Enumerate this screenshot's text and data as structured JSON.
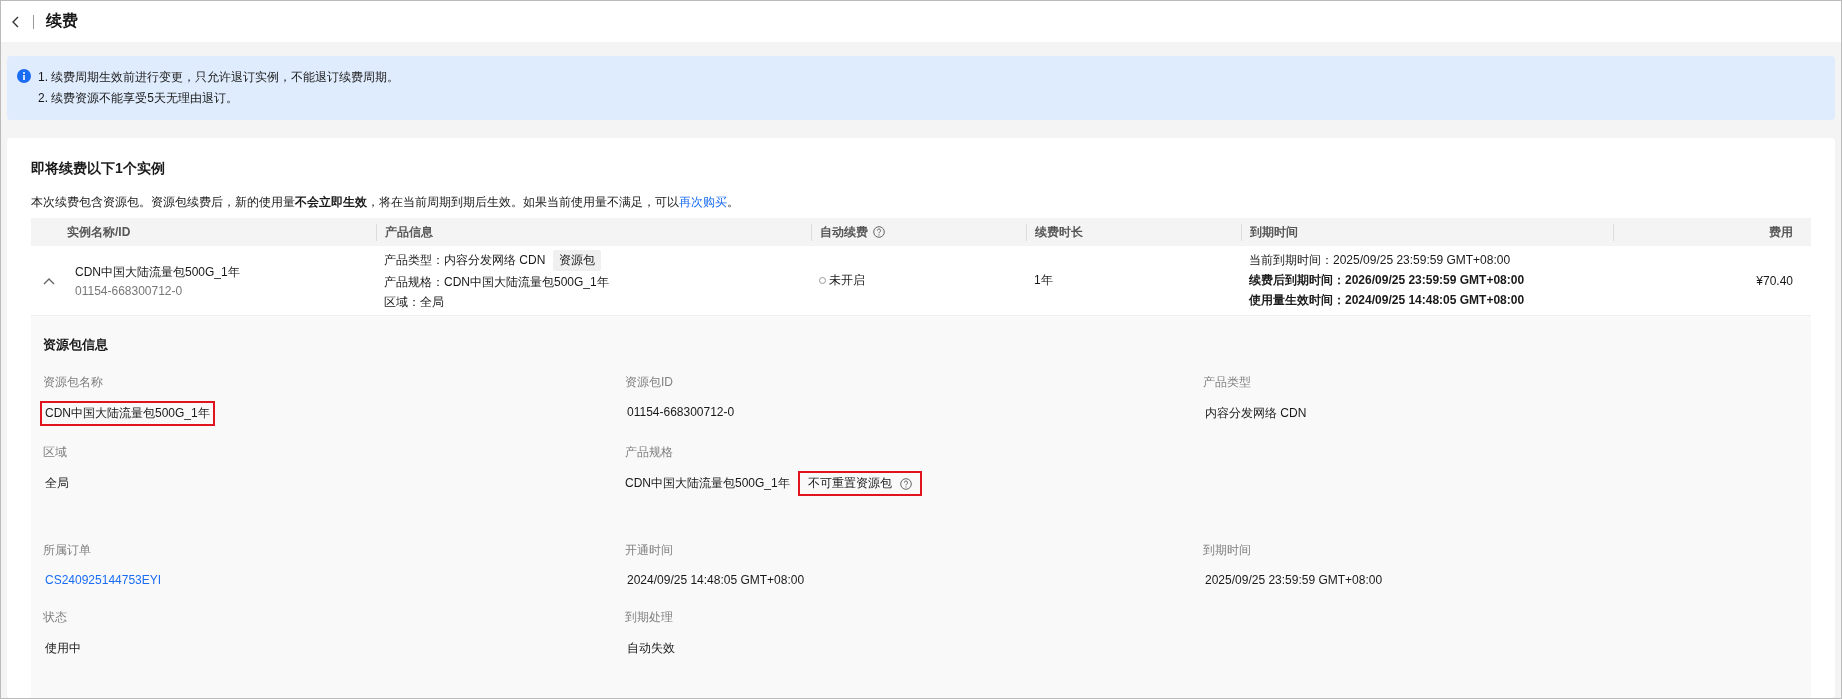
{
  "header": {
    "title": "续费"
  },
  "notice": {
    "lines": [
      "1. 续费周期生效前进行变更，只允许退订实例，不能退订续费周期。",
      "2. 续费资源不能享受5天无理由退订。"
    ]
  },
  "section": {
    "title": "即将续费以下1个实例",
    "description": "本次续费包含资源包。资源包续费后，新的使用量**不会立即生效**，将在当前周期到期后生效。如果当前使用量不满足，可以",
    "link": "再次购买",
    "description_end": "。"
  },
  "table": {
    "columns": [
      {
        "label": "实例名称/ID"
      },
      {
        "label": "产品信息"
      },
      {
        "label": "自动续费",
        "help": true
      },
      {
        "label": "续费时长"
      },
      {
        "label": "到期时间"
      },
      {
        "label": "费用"
      }
    ],
    "rows": [
      {
        "expanded": true,
        "name": "CDN中国大陆流量包500G_1年",
        "id": "01154-668300712-0",
        "product_lines": [
          {
            "text": "产品类型：内容分发网络 CDN",
            "tag": "资源包"
          },
          {
            "text": "产品规格：CDN中国大陆流量包500G_1年"
          },
          {
            "text": "区域：全局"
          }
        ],
        "auto_renew": {
          "label": "未开启",
          "on": false
        },
        "duration": "1年",
        "expiry_lines": [
          {
            "text": "当前到期时间：2025/09/25 23:59:59 GMT+08:00",
            "bold": false
          },
          {
            "text": "续费后到期时间：2026/09/25 23:59:59 GMT+08:00",
            "bold": true
          },
          {
            "text": "使用量生效时间：2024/09/25 14:48:05 GMT+08:00",
            "bold": true
          }
        ],
        "fee": "¥70.40"
      }
    ]
  },
  "details": {
    "title": "资源包信息",
    "fields": [
      {
        "label": "资源包名称",
        "value": "CDN中国大陆流量包500G_1年",
        "kind": "text",
        "highlighted": true
      },
      {
        "label": "资源包ID",
        "value": "01154-668300712-0",
        "kind": "text",
        "highlighted": false
      },
      {
        "label": "产品类型",
        "value": "内容分发网络 CDN",
        "kind": "text",
        "highlighted": false
      },
      {
        "label": "区域",
        "value": "全局",
        "kind": "text",
        "highlighted": false
      },
      {
        "label": "产品规格",
        "value": "CDN中国大陆流量包500G_1年",
        "kind": "spec",
        "note": "不可重置资源包",
        "highlighted": true
      },
      {
        "kind": "empty"
      },
      {
        "label": "所属订单",
        "value": "CS240925144753EYI",
        "kind": "link",
        "highlighted": false
      },
      {
        "label": "开通时间",
        "value": "2024/09/25 14:48:05 GMT+08:00",
        "kind": "text",
        "highlighted": false
      },
      {
        "label": "到期时间",
        "value": "2025/09/25 23:59:59 GMT+08:00",
        "kind": "text",
        "highlighted": false
      },
      {
        "label": "状态",
        "value": "使用中",
        "kind": "text",
        "highlighted": false
      },
      {
        "label": "到期处理",
        "value": "自动失效",
        "kind": "text",
        "highlighted": false
      }
    ]
  }
}
